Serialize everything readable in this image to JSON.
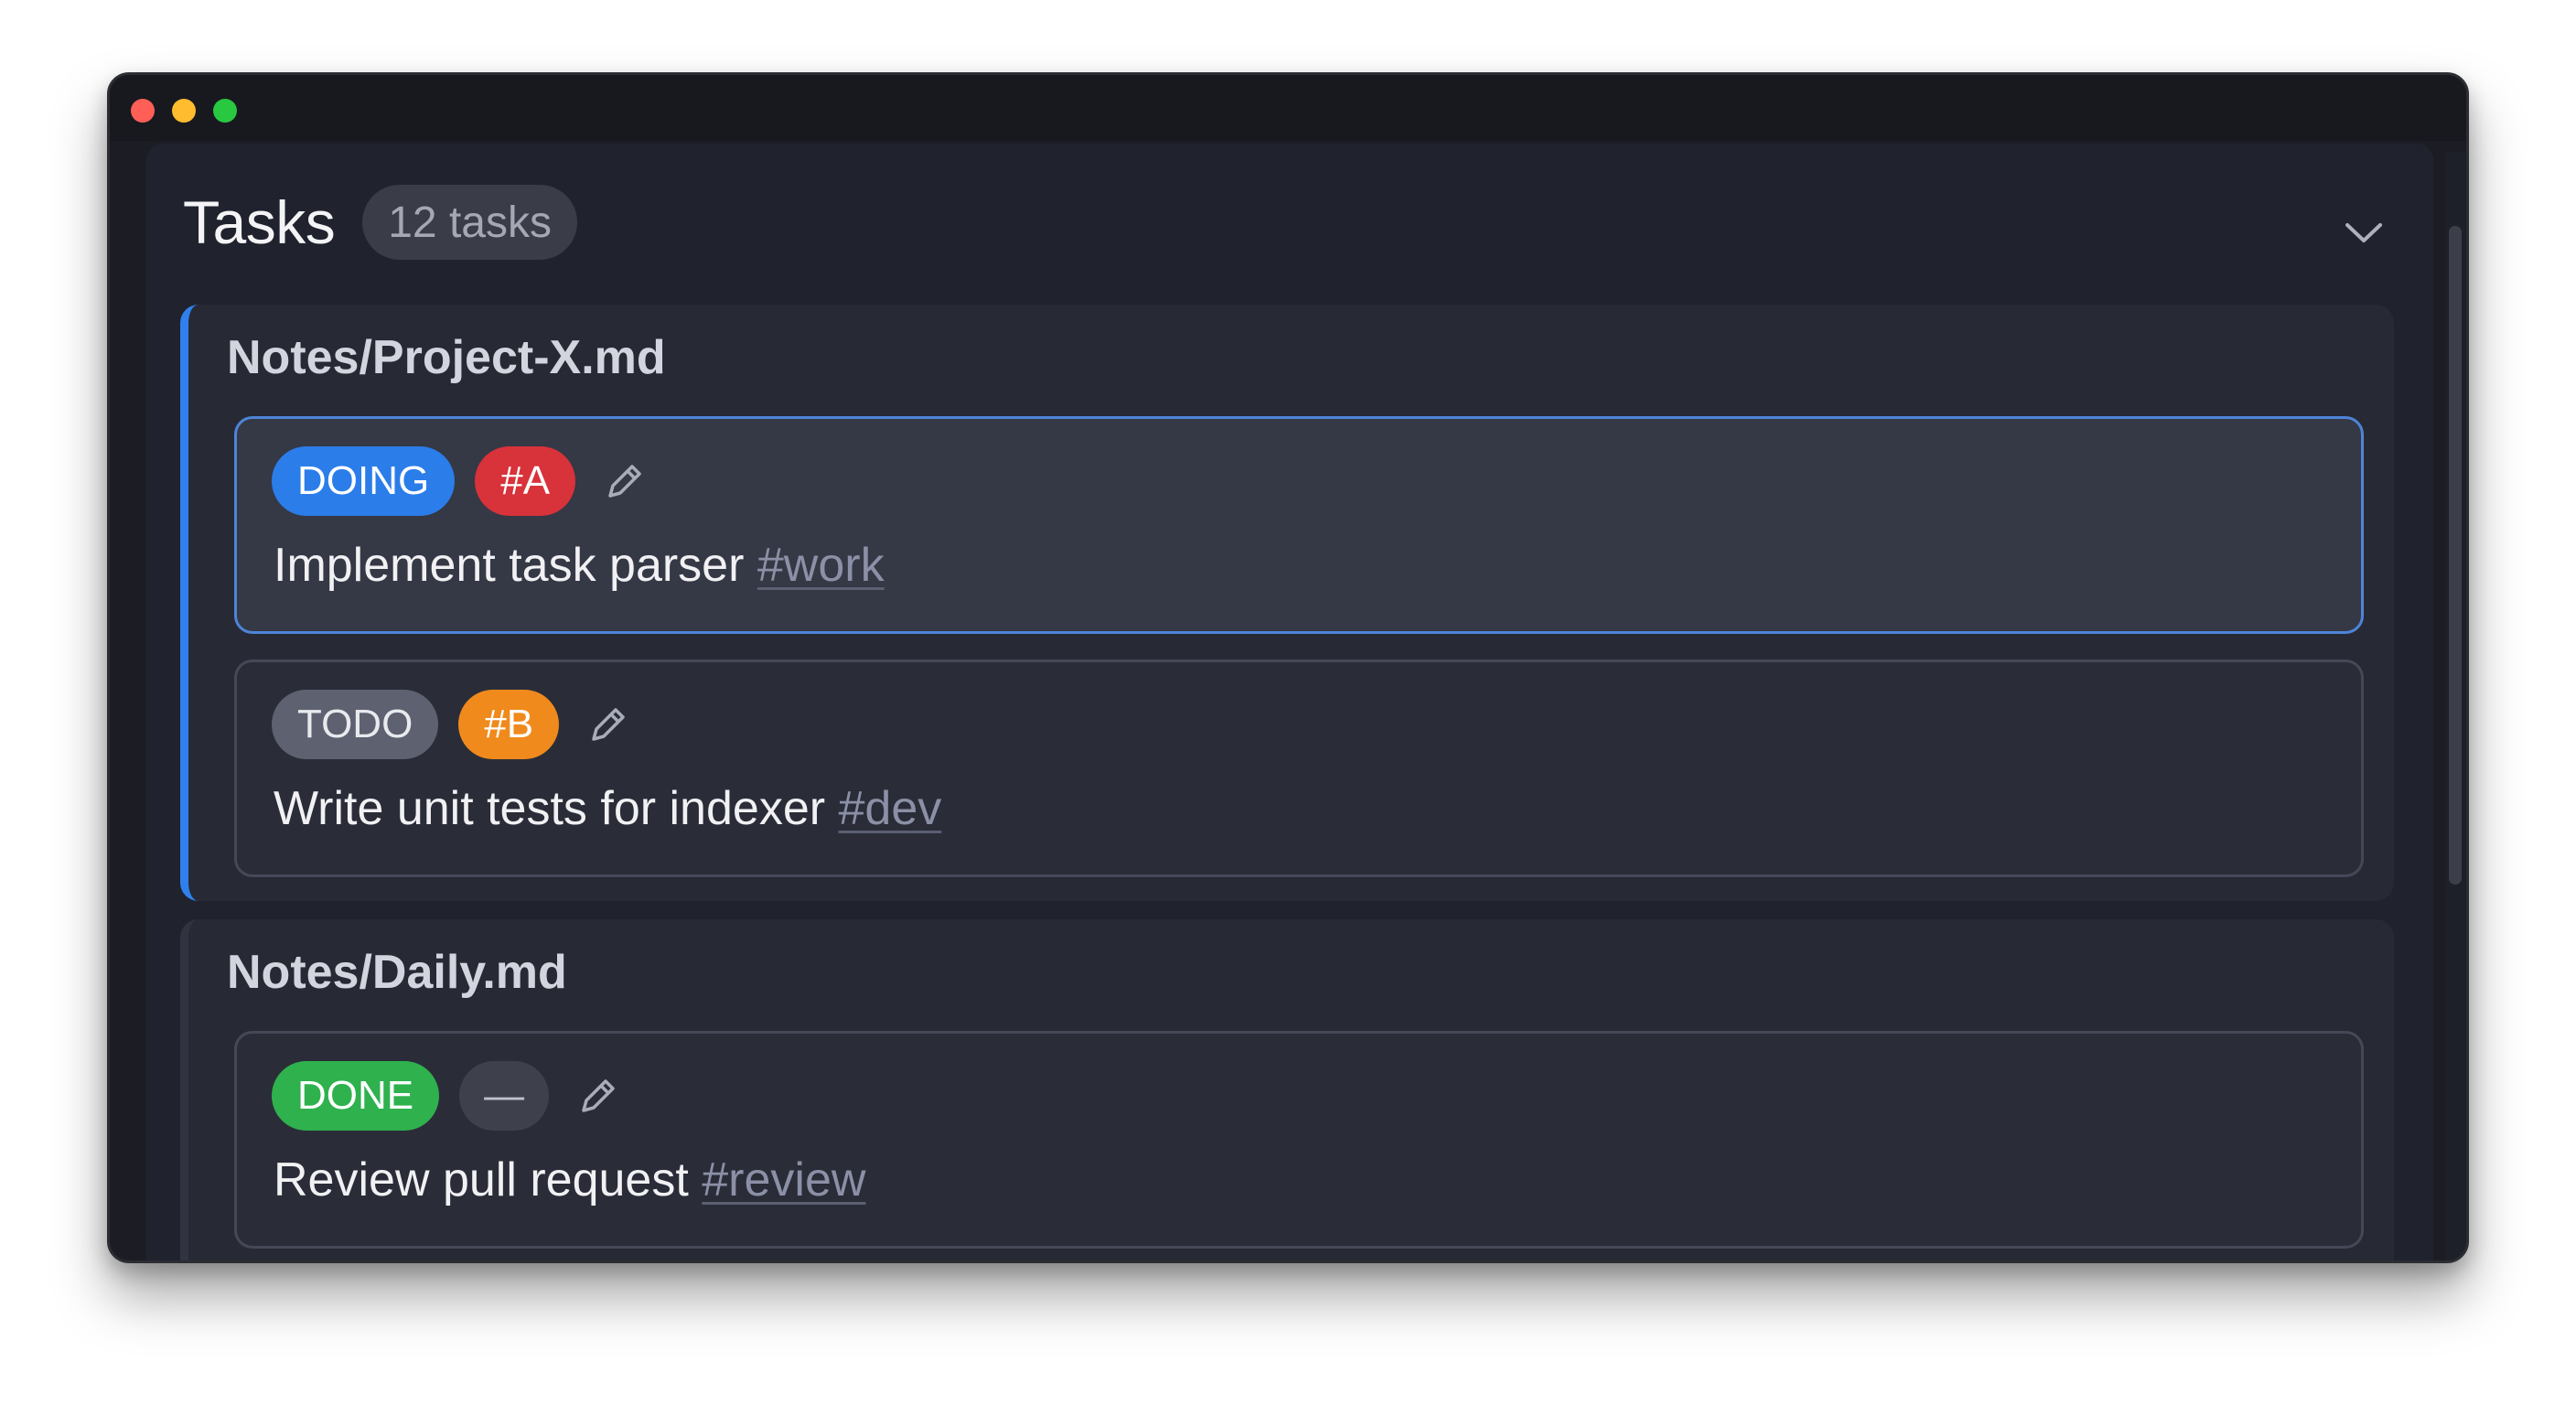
{
  "header": {
    "title": "Tasks",
    "count": "12 tasks"
  },
  "icons": {
    "collapse": "chevron-down-icon",
    "edit": "pencil-icon"
  },
  "colors": {
    "accent": "#2f80ed",
    "doing": "#2b7de9",
    "todo": "#5e6170",
    "done": "#2fb14e",
    "priority_a": "#d8323a",
    "priority_b": "#f08a1c"
  },
  "groups": [
    {
      "file": "Notes/Project-X.md",
      "tasks": [
        {
          "status": "DOING",
          "priority": "#A",
          "text": "Implement task parser",
          "tag": "#work"
        },
        {
          "status": "TODO",
          "priority": "#B",
          "text": "Write unit tests for indexer",
          "tag": "#dev"
        }
      ]
    },
    {
      "file": "Notes/Daily.md",
      "tasks": [
        {
          "status": "DONE",
          "priority": "—",
          "text": "Review pull request",
          "tag": "#review"
        }
      ]
    }
  ]
}
